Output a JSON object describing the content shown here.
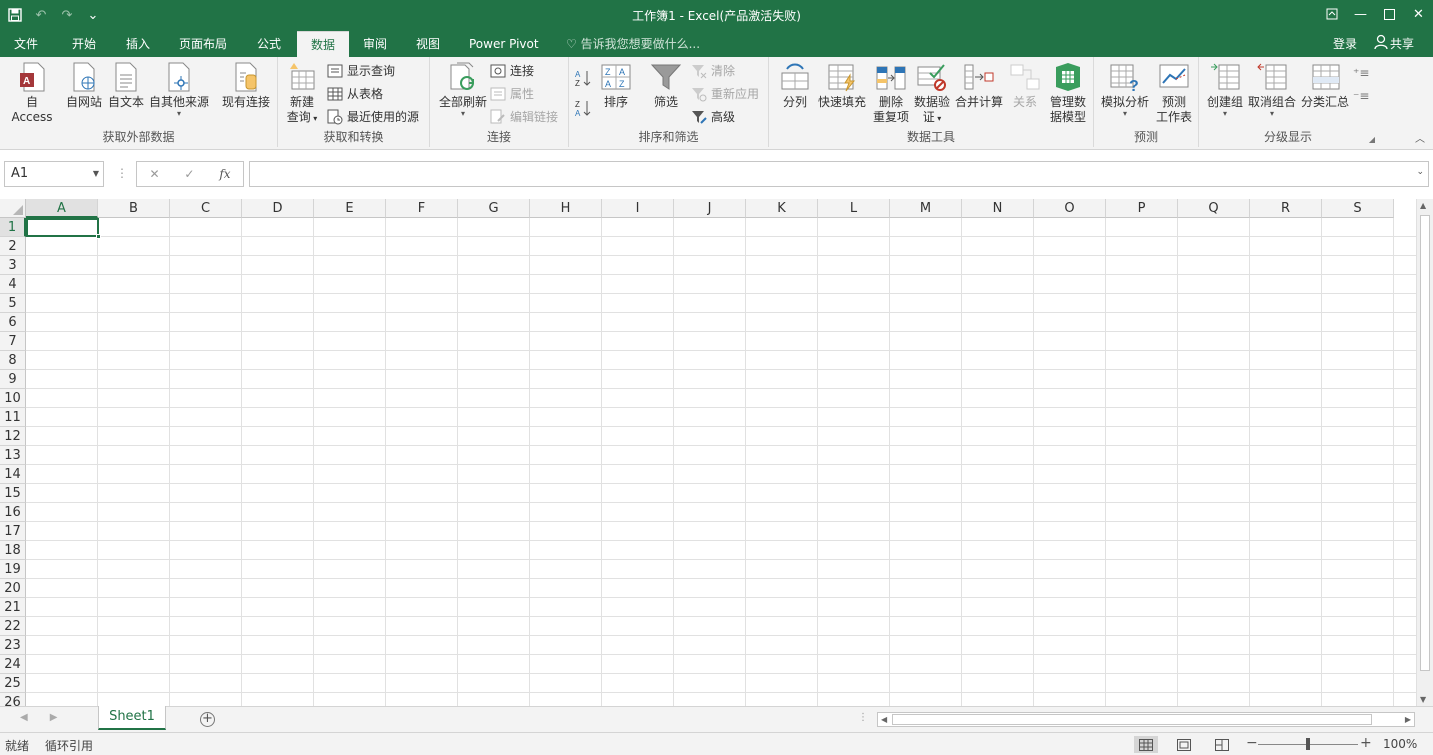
{
  "window": {
    "title": "工作簿1 - Excel(产品激活失败)"
  },
  "tabs": [
    {
      "label": "文件"
    },
    {
      "label": "开始"
    },
    {
      "label": "插入"
    },
    {
      "label": "页面布局"
    },
    {
      "label": "公式"
    },
    {
      "label": "数据",
      "active": true
    },
    {
      "label": "审阅"
    },
    {
      "label": "视图"
    },
    {
      "label": "Power Pivot"
    }
  ],
  "tellme": "告诉我您想要做什么...",
  "account": {
    "login": "登录",
    "share": "共享"
  },
  "ribbon": {
    "external": {
      "label": "获取外部数据",
      "access": "自 Access",
      "web": "自网站",
      "text": "自文本",
      "other": "自其他来源",
      "existing": "现有连接"
    },
    "transform": {
      "label": "获取和转换",
      "newquery_1": "新建",
      "newquery_2": "查询",
      "showquery": "显示查询",
      "fromtable": "从表格",
      "recent": "最近使用的源"
    },
    "connections": {
      "label": "连接",
      "refresh": "全部刷新",
      "connections": "连接",
      "properties": "属性",
      "editlinks": "编辑链接"
    },
    "sortfilter": {
      "label": "排序和筛选",
      "sort": "排序",
      "filter": "筛选",
      "clear": "清除",
      "reapply": "重新应用",
      "advanced": "高级"
    },
    "datatools": {
      "label": "数据工具",
      "split": "分列",
      "flashfill": "快速填充",
      "removedup_1": "删除",
      "removedup_2": "重复项",
      "validation_1": "数据验",
      "validation_2": "证",
      "consolidate": "合并计算",
      "relations": "关系",
      "datamodel_1": "管理数",
      "datamodel_2": "据模型"
    },
    "forecast": {
      "label": "预测",
      "whatif": "模拟分析",
      "sheet_1": "预测",
      "sheet_2": "工作表"
    },
    "outline": {
      "label": "分级显示",
      "group": "创建组",
      "ungroup": "取消组合",
      "subtotal": "分类汇总"
    }
  },
  "formula": {
    "namebox": "A1",
    "fx": "fx",
    "value": ""
  },
  "columns": [
    "A",
    "B",
    "C",
    "D",
    "E",
    "F",
    "G",
    "H",
    "I",
    "J",
    "K",
    "L",
    "M",
    "N",
    "O",
    "P",
    "Q",
    "R",
    "S"
  ],
  "rows": [
    "1",
    "2",
    "3",
    "4",
    "5",
    "6",
    "7",
    "8",
    "9",
    "10",
    "11",
    "12",
    "13",
    "14",
    "15",
    "16",
    "17",
    "18",
    "19",
    "20",
    "21",
    "22",
    "23",
    "24",
    "25",
    "26"
  ],
  "sheets": [
    {
      "name": "Sheet1",
      "active": true
    }
  ],
  "status": {
    "ready": "就绪",
    "circular": "循环引用",
    "zoom": "100%",
    "zoom_level": 1.0
  },
  "colors": {
    "accent": "#217346",
    "ribbon_bg": "#f3f3f3",
    "grid_line": "#e1e1e1"
  }
}
